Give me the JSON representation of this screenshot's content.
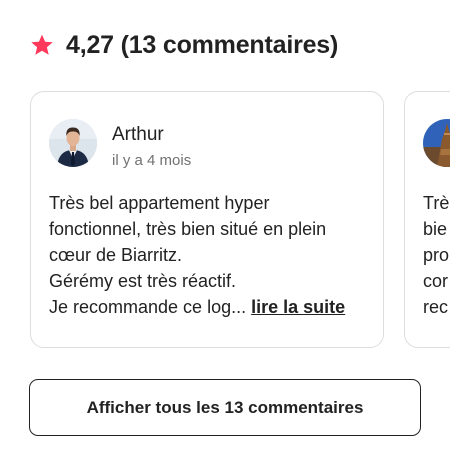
{
  "header": {
    "rating_text": "4,27 (13 commentaires)",
    "star_color": "#ff385c"
  },
  "reviews": [
    {
      "name": "Arthur",
      "date": "il y a 4 mois",
      "avatar": "man-in-suit-photo",
      "lines": [
        "Très bel appartement hyper",
        "fonctionnel, très bien situé en plein",
        "cœur de Biarritz.",
        "Gérémy est très réactif."
      ],
      "last_line": "Je recommande ce log...",
      "read_more": "lire la suite"
    },
    {
      "avatar": "tower-photo",
      "lines": [
        "Trè",
        "bie",
        "pro",
        "cor",
        "rec"
      ]
    }
  ],
  "actions": {
    "show_all_label": "Afficher tous les 13 commentaires"
  }
}
